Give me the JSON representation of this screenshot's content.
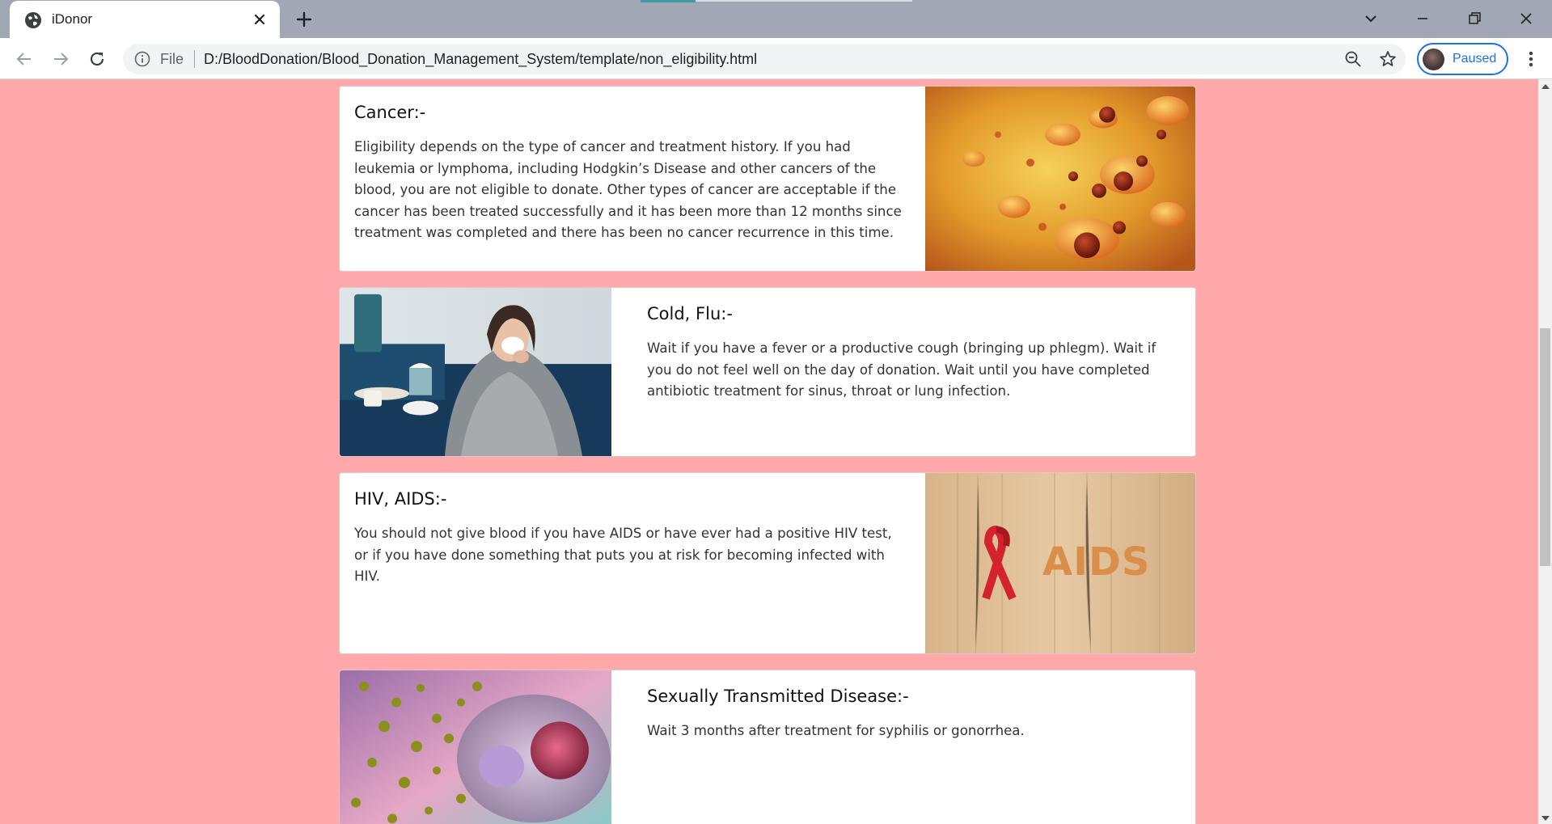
{
  "browser": {
    "tab_title": "iDonor",
    "url_scheme": "File",
    "url": "D:/BloodDonation/Blood_Donation_Management_System/template/non_eligibility.html",
    "profile_label": "Paused",
    "accent_color": "#1a73e8"
  },
  "page": {
    "background_color": "#ffa8a9",
    "cards": [
      {
        "title": "Cancer:-",
        "body": "Eligibility depends on the type of cancer and treatment history. If you had leukemia or lymphoma, including Hodgkin’s Disease and other cancers of the blood, you are not eligible to donate. Other types of cancer are acceptable if the cancer has been treated successfully and it has been more than 12 months since treatment was completed and there has been no cancer recurrence in this time.",
        "image": "cancer-cells-image"
      },
      {
        "title": "Cold, Flu:-",
        "body": "Wait if you have a fever or a productive cough (bringing up phlegm). Wait if you do not feel well on the day of donation. Wait until you have completed antibiotic treatment for sinus, throat or lung infection.",
        "image": "sick-woman-blanket-image"
      },
      {
        "title": "HIV, AIDS:-",
        "body": "You should not give blood if you have AIDS or have ever had a positive HIV test, or if you have done something that puts you at risk for becoming infected with HIV.",
        "image": "aids-ribbon-image",
        "image_text": "AIDS"
      },
      {
        "title": "Sexually Transmitted Disease:-",
        "body": "Wait 3 months after treatment for syphilis or gonorrhea.",
        "image": "bacteria-cell-image"
      }
    ]
  }
}
